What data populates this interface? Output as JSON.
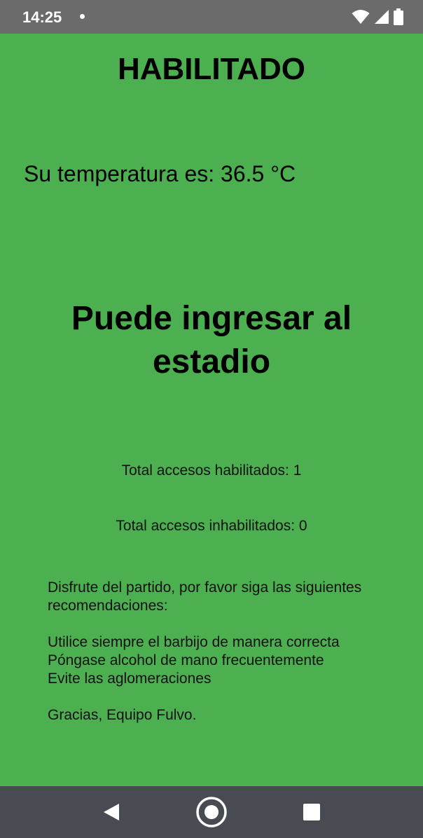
{
  "status_bar": {
    "time": "14:25",
    "icons": [
      "notification-dot-icon",
      "wifi-icon",
      "signal-icon",
      "battery-icon"
    ]
  },
  "screen": {
    "title": "HABILITADO",
    "temperature": "Su temperatura es: 36.5 °C",
    "message": "Puede ingresar al estadio",
    "enabled_count": "Total accesos habilitados: 1",
    "disabled_count": "Total accesos inhabilitados: 0",
    "info": {
      "intro": "Disfrute del partido, por favor siga las siguientes recomendaciones:",
      "recommendations": [
        "Utilice siempre el barbijo de manera correcta",
        "Póngase alcohol de mano frecuentemente",
        "Evite las aglomeraciones"
      ],
      "closing": "Gracias, Equipo Fulvo."
    }
  },
  "colors": {
    "background": "#4caf50",
    "status_bar": "#6b6b6b",
    "nav_bar": "#484c52"
  },
  "nav_bar": {
    "buttons": [
      "back-icon",
      "home-icon",
      "recents-icon"
    ]
  }
}
